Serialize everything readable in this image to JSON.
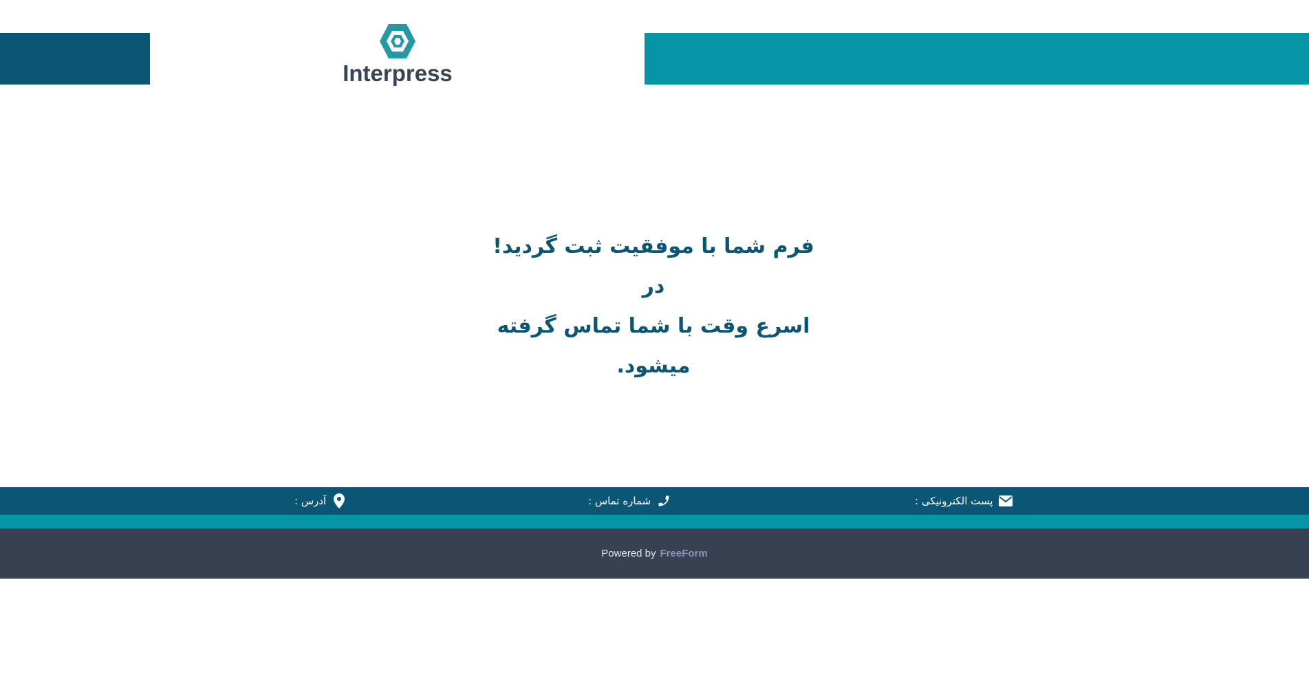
{
  "header": {
    "logo_text": "Interpress",
    "logo_icon": "hexagon-logo-icon",
    "colors": {
      "dark_bar": "#0b5675",
      "accent_bar": "#0595a7",
      "logo": "#2399a6"
    }
  },
  "main": {
    "message_line1": "فرم شما با موفقیت ثبت گردید!در",
    "message_line2": "اسرع وقت با شما تماس گرفته",
    "message_line3": "میشود."
  },
  "contact": {
    "email_label": "پست الکترونیکی :",
    "phone_label": "شماره تماس :",
    "address_label": "آدرس :",
    "email_icon": "mail-icon",
    "phone_icon": "phone-icon",
    "address_icon": "location-pin-icon"
  },
  "footer": {
    "powered_by": "Powered by",
    "brand": "FreeForm",
    "colors": {
      "bg": "#374151",
      "brand": "#8b93b8"
    }
  }
}
